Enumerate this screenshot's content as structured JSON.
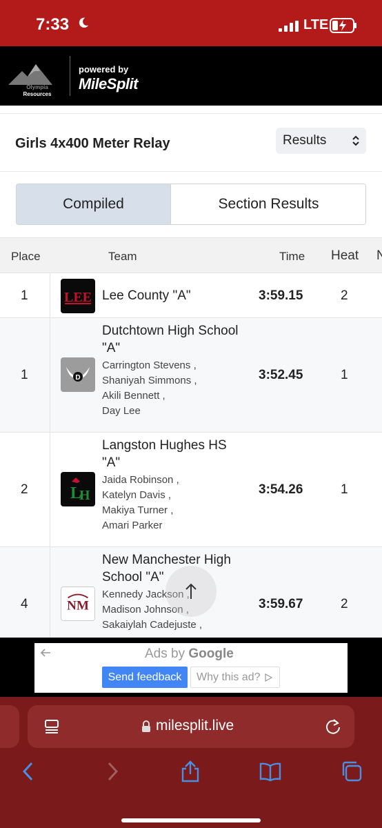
{
  "status_bar": {
    "time": "7:33",
    "carrier": "LTE"
  },
  "header": {
    "sponsor_line1": "Olympia",
    "sponsor_line2": "Resources",
    "powered_by": "powered by",
    "brand": "MileSplit"
  },
  "event": {
    "title": "Girls 4x400 Meter Relay",
    "view_select": "Results"
  },
  "tabs": {
    "compiled": "Compiled",
    "section": "Section Results"
  },
  "table": {
    "headers": {
      "place": "Place",
      "team": "Team",
      "time": "Time",
      "heat": "Heat",
      "overflow": "N"
    },
    "rows": [
      {
        "place": "1",
        "team": "Lee County \"A\"",
        "athletes": [],
        "time": "3:59.15",
        "heat": "2",
        "logo": "lee-county-logo"
      },
      {
        "place": "1",
        "team": "Dutchtown High School \"A\"",
        "athletes": [
          "Carrington Stevens ,",
          "Shaniyah Simmons ,",
          "Akili Bennett ,",
          "Day Lee"
        ],
        "time": "3:52.45",
        "heat": "1",
        "logo": "dutchtown-logo"
      },
      {
        "place": "2",
        "team": "Langston Hughes HS \"A\"",
        "athletes": [
          "Jaida Robinson ,",
          "Katelyn Davis ,",
          "Makiya Turner ,",
          "Amari Parker"
        ],
        "time": "3:54.26",
        "heat": "1",
        "logo": "langston-hughes-logo"
      },
      {
        "place": "4",
        "team": "New Manchester High School \"A\"",
        "athletes": [
          "Kennedy Jackson ,",
          "Madison Johnson ,",
          "Sakaiylah Cadejuste ,"
        ],
        "time": "3:59.67",
        "heat": "2",
        "logo": "new-manchester-logo"
      }
    ]
  },
  "ad": {
    "ads_by": "Ads by",
    "google": "Google",
    "send_feedback": "Send feedback",
    "why_ad": "Why this ad?"
  },
  "browser": {
    "url": "milesplit.live"
  },
  "colors": {
    "status_red": "#b31b1b",
    "browser_red": "#7a1a1a",
    "tab_active": "#d7dfea",
    "google_blue": "#4285f4"
  }
}
